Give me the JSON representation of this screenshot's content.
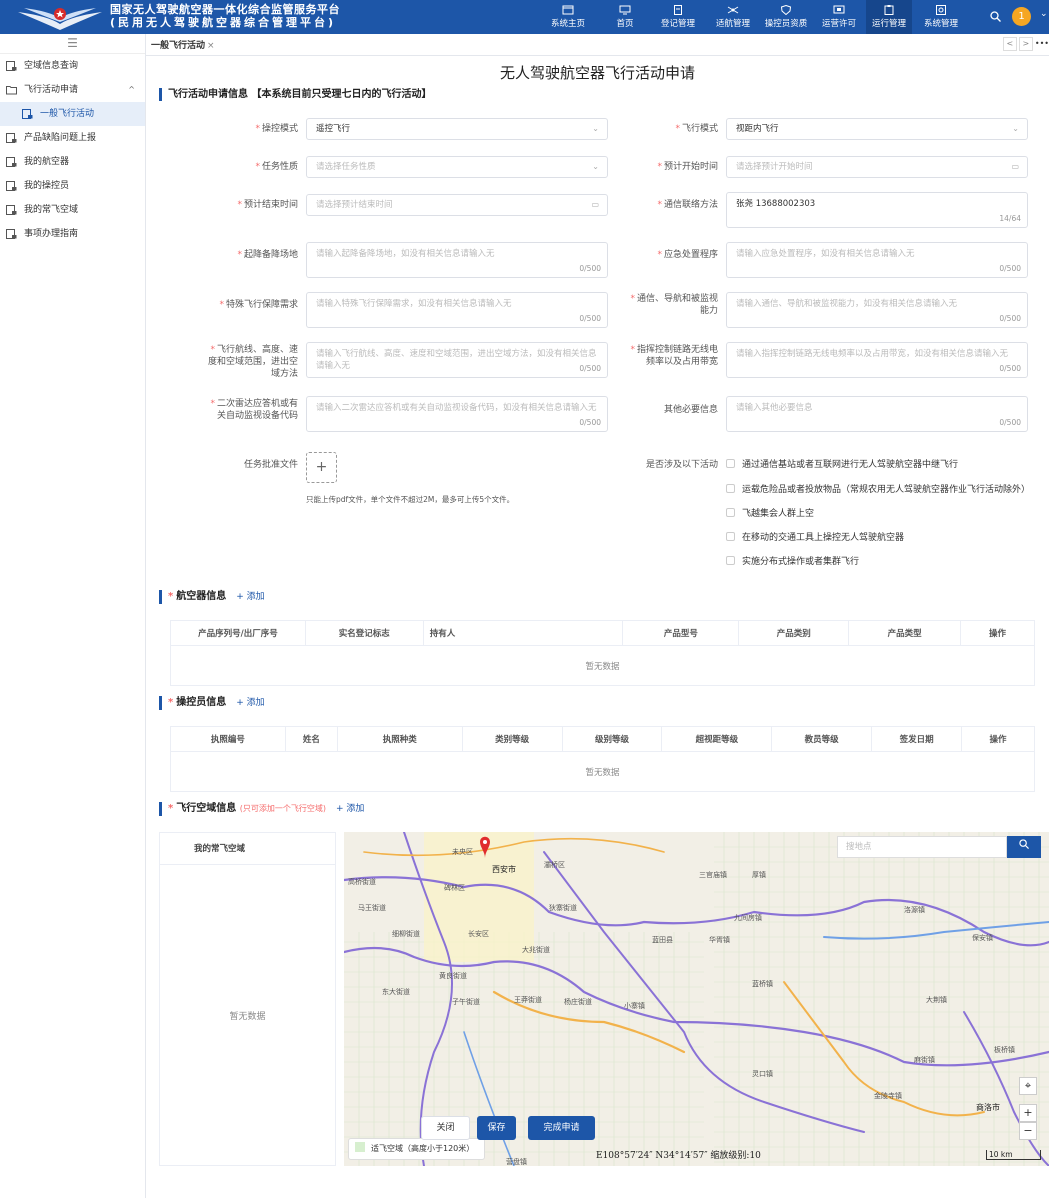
{
  "header": {
    "system_name_line1": "国家无人驾驶航空器一体化综合监管服务平台",
    "system_name_line2": "(民用无人驾驶航空器综合管理平台)",
    "nav": [
      {
        "label": "系统主页",
        "icon": "folder-icon"
      },
      {
        "label": "首页",
        "icon": "monitor-icon"
      },
      {
        "label": "登记管理",
        "icon": "document-icon"
      },
      {
        "label": "适航管理",
        "icon": "drone-icon"
      },
      {
        "label": "操控员资质",
        "icon": "shield-icon"
      },
      {
        "label": "运营许可",
        "icon": "license-icon"
      },
      {
        "label": "运行管理",
        "icon": "clipboard-icon",
        "active": true
      },
      {
        "label": "系统管理",
        "icon": "settings-icon"
      }
    ],
    "avatar_text": "1"
  },
  "sidebar": {
    "items": [
      {
        "label": "空域信息查询"
      },
      {
        "label": "飞行活动申请"
      },
      {
        "label": "一般飞行活动"
      },
      {
        "label": "产品缺陷问题上报"
      },
      {
        "label": "我的航空器"
      },
      {
        "label": "我的操控员"
      },
      {
        "label": "我的常飞空域"
      },
      {
        "label": "事项办理指南"
      }
    ]
  },
  "tabs": {
    "active": "一般飞行活动",
    "close": "×",
    "prev": "<",
    "next": ">",
    "more": "•••"
  },
  "page": {
    "title": "无人驾驶航空器飞行活动申请",
    "section_basic": "飞行活动申请信息 【本系统目前只受理七日内的飞行活动】",
    "req_mark": "*",
    "fields": {
      "control_mode": {
        "label": "操控模式",
        "value": "遥控飞行"
      },
      "flight_mode": {
        "label": "飞行模式",
        "value": "视距内飞行"
      },
      "task_nature": {
        "label": "任务性质",
        "placeholder": "请选择任务性质"
      },
      "start_time": {
        "label": "预计开始时间",
        "placeholder": "请选择预计开始时间"
      },
      "end_time": {
        "label": "预计结束时间",
        "placeholder": "请选择预计结束时间"
      },
      "contact": {
        "label": "通信联络方法",
        "value": "张尧 13688002303",
        "count": "14/64"
      },
      "alt_site": {
        "label": "起降备降场地",
        "placeholder": "请输入起降备降场地，如没有相关信息请输入无",
        "count": "0/500"
      },
      "emergency": {
        "label": "应急处置程序",
        "placeholder": "请输入应急处置程序，如没有相关信息请输入无",
        "count": "0/500"
      },
      "special": {
        "label": "特殊飞行保障需求",
        "placeholder": "请输入特殊飞行保障需求，如没有相关信息请输入无",
        "count": "0/500"
      },
      "comm_nav": {
        "label": "通信、导航和被监视能力",
        "placeholder": "请输入通信、导航和被监视能力，如没有相关信息请输入无",
        "count": "0/500"
      },
      "route": {
        "label": "飞行航线、高度、速度和空域范围，进出空域方法",
        "placeholder": "请输入飞行航线、高度、速度和空域范围，进出空域方法，如没有相关信息请输入无",
        "count": "0/500"
      },
      "c2_link": {
        "label": "指挥控制链路无线电频率以及占用带宽",
        "placeholder": "请输入指挥控制链路无线电频率以及占用带宽，如没有相关信息请输入无",
        "count": "0/500"
      },
      "transponder": {
        "label": "二次雷达应答机或有关自动监视设备代码",
        "placeholder": "请输入二次雷达应答机或有关自动监视设备代码，如没有相关信息请输入无",
        "count": "0/500"
      },
      "other": {
        "label": "其他必要信息",
        "placeholder": "请输入其他必要信息",
        "count": "0/500"
      }
    },
    "upload": {
      "label": "任务批准文件",
      "plus": "+",
      "hint": "只能上传pdf文件，单个文件不超过2M，最多可上传5个文件。"
    },
    "activities": {
      "label": "是否涉及以下活动",
      "options": [
        "通过通信基站或者互联网进行无人驾驶航空器中继飞行",
        "运载危险品或者投放物品（常规农用无人驾驶航空器作业飞行活动除外）",
        "飞越集会人群上空",
        "在移动的交通工具上操控无人驾驶航空器",
        "实施分布式操作或者集群飞行"
      ]
    },
    "aircraft": {
      "title": "航空器信息",
      "add": "+ 添加",
      "columns": [
        "产品序列号/出厂序号",
        "实名登记标志",
        "持有人",
        "产品型号",
        "产品类别",
        "产品类型",
        "操作"
      ],
      "empty": "暂无数据"
    },
    "operator": {
      "title": "操控员信息",
      "add": "+ 添加",
      "columns": [
        "执照编号",
        "姓名",
        "执照种类",
        "类别等级",
        "级别等级",
        "超视距等级",
        "教员等级",
        "签发日期",
        "操作"
      ],
      "empty": "暂无数据"
    },
    "airspace": {
      "title": "飞行空域信息",
      "note": "(只可添加一个飞行空域)",
      "add": "+ 添加",
      "my_header": "我的常飞空域",
      "empty": "暂无数据"
    },
    "map": {
      "search_placeholder": "搜地点",
      "legend": "适飞空域（高度小于120米）",
      "coords": "E108°57′24″  N34°14′57″  缩放级别:10",
      "scale": "10 km",
      "labels": [
        "未央区",
        "西安市",
        "灞桥区",
        "碑林区",
        "高桥街道",
        "马王街道",
        "细柳街道",
        "长安区",
        "大兆街道",
        "狄寨街道",
        "蓝田县",
        "华胥镇",
        "三官庙镇",
        "厚镇",
        "九间房镇",
        "洛源镇",
        "保安镇",
        "黄良街道",
        "东大街道",
        "子午街道",
        "王莽街道",
        "杨庄街道",
        "小寨镇",
        "蓝桥镇",
        "大荆镇",
        "麻街镇",
        "板桥镇",
        "金陵寺镇",
        "商洛市",
        "营盘镇",
        "灵口镇"
      ]
    },
    "buttons": {
      "close": "关闭",
      "save": "保存",
      "submit": "完成申请"
    }
  }
}
